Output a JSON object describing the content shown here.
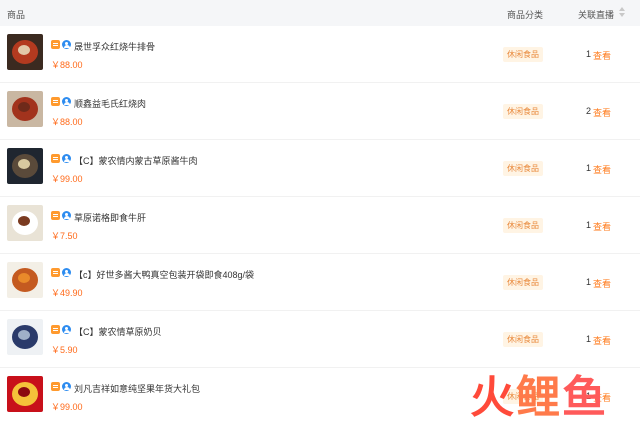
{
  "table": {
    "headers": {
      "product": "商品",
      "category": "商品分类",
      "live": "关联直播"
    },
    "rows": [
      {
        "name": "晟世孚众红烧牛排骨",
        "price": "￥88.00",
        "category": "休闲食品",
        "live_count": "1",
        "view_label": "查看",
        "thumb_colors": [
          "#3b2a20",
          "#b33a1f",
          "#e2c8a8"
        ]
      },
      {
        "name": "顺鑫益毛氏红烧肉",
        "price": "￥88.00",
        "category": "休闲食品",
        "live_count": "2",
        "view_label": "查看",
        "thumb_colors": [
          "#c9b7a2",
          "#a2331d",
          "#6f2a1a"
        ]
      },
      {
        "name": "【C】蒙农情内蒙古草原酱牛肉",
        "price": "￥99.00",
        "category": "休闲食品",
        "live_count": "1",
        "view_label": "查看",
        "thumb_colors": [
          "#1f2630",
          "#5a4a3a",
          "#d8c9a0"
        ]
      },
      {
        "name": "草原诺格即食牛肝",
        "price": "￥7.50",
        "category": "休闲食品",
        "live_count": "1",
        "view_label": "查看",
        "thumb_colors": [
          "#e9e3d6",
          "#ffffff",
          "#7a3a20"
        ]
      },
      {
        "name": "【c】好世多酱大鸭真空包装开袋即食408g/袋",
        "price": "￥49.90",
        "category": "休闲食品",
        "live_count": "1",
        "view_label": "查看",
        "thumb_colors": [
          "#f3efe6",
          "#c45a20",
          "#e98a2a"
        ]
      },
      {
        "name": "【C】蒙农情草原奶贝",
        "price": "￥5.90",
        "category": "休闲食品",
        "live_count": "1",
        "view_label": "查看",
        "thumb_colors": [
          "#eef1f4",
          "#2a3a6a",
          "#9fb0c8"
        ]
      },
      {
        "name": "刘凡吉祥如意纯坚果年货大礼包",
        "price": "￥99.00",
        "category": "休闲食品",
        "live_count": "1",
        "view_label": "查看",
        "thumb_colors": [
          "#c8101a",
          "#f5c23a",
          "#8a0a10"
        ]
      }
    ]
  },
  "watermark": {
    "logo_text": "火鲤鱼"
  },
  "colors": {
    "price": "#ff6a1a",
    "link": "#ff7a1a",
    "tag_bg": "#fff4e4",
    "tag_text": "#e98a3d",
    "header_bg": "#f5f6f8"
  }
}
